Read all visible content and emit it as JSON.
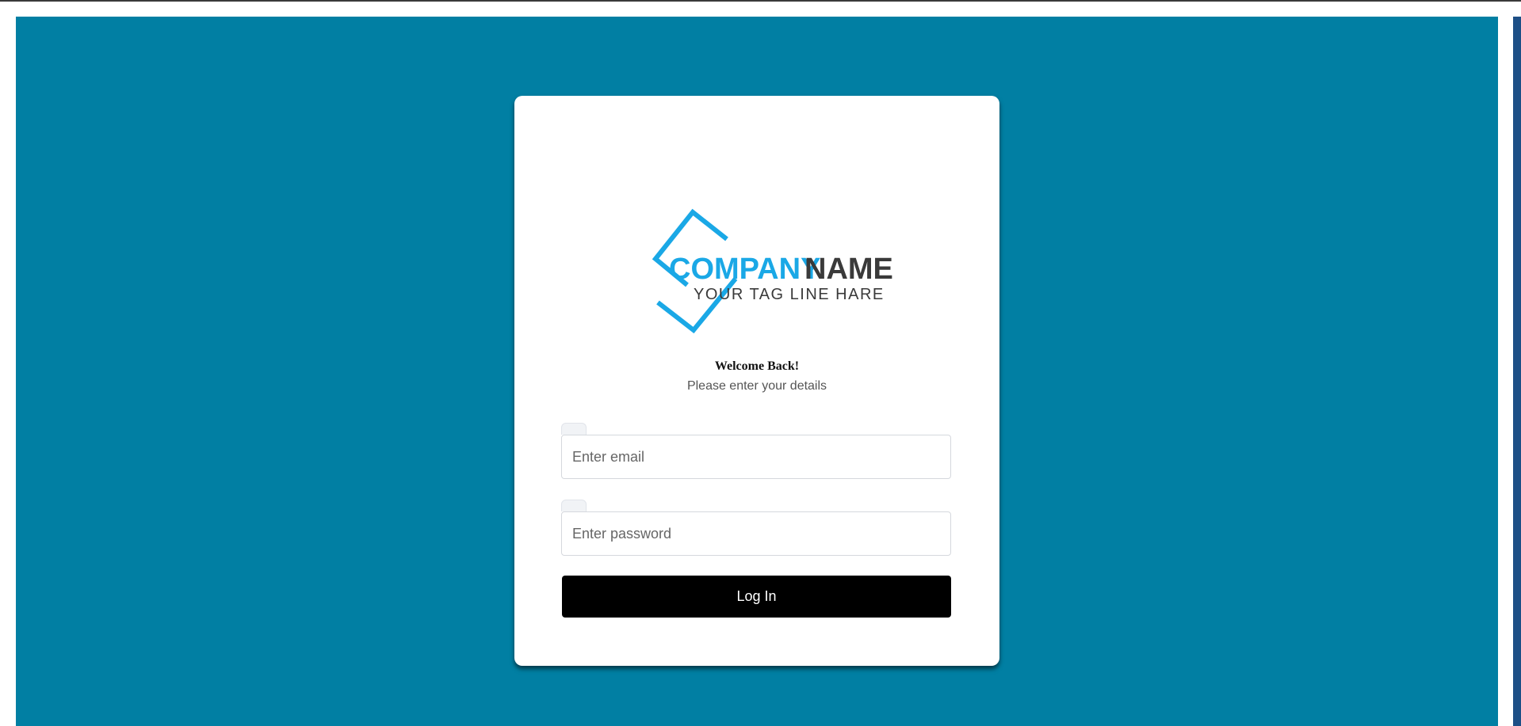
{
  "colors": {
    "page_background": "#017fa3",
    "card_background": "#ffffff",
    "brand_blue": "#1aa8e6",
    "brand_dark": "#3a3a3a",
    "button_background": "#000000",
    "button_text": "#ffffff"
  },
  "logo": {
    "company_word": "COMPANY",
    "name_word": "NAME",
    "tagline": "YOUR TAG LINE HARE",
    "icon": "diamond-frame-icon"
  },
  "welcome": {
    "title": "Welcome Back!",
    "subtitle": "Please enter your details"
  },
  "form": {
    "email": {
      "placeholder": "Enter email",
      "value": ""
    },
    "password": {
      "placeholder": "Enter password",
      "value": ""
    },
    "submit_label": "Log In"
  }
}
